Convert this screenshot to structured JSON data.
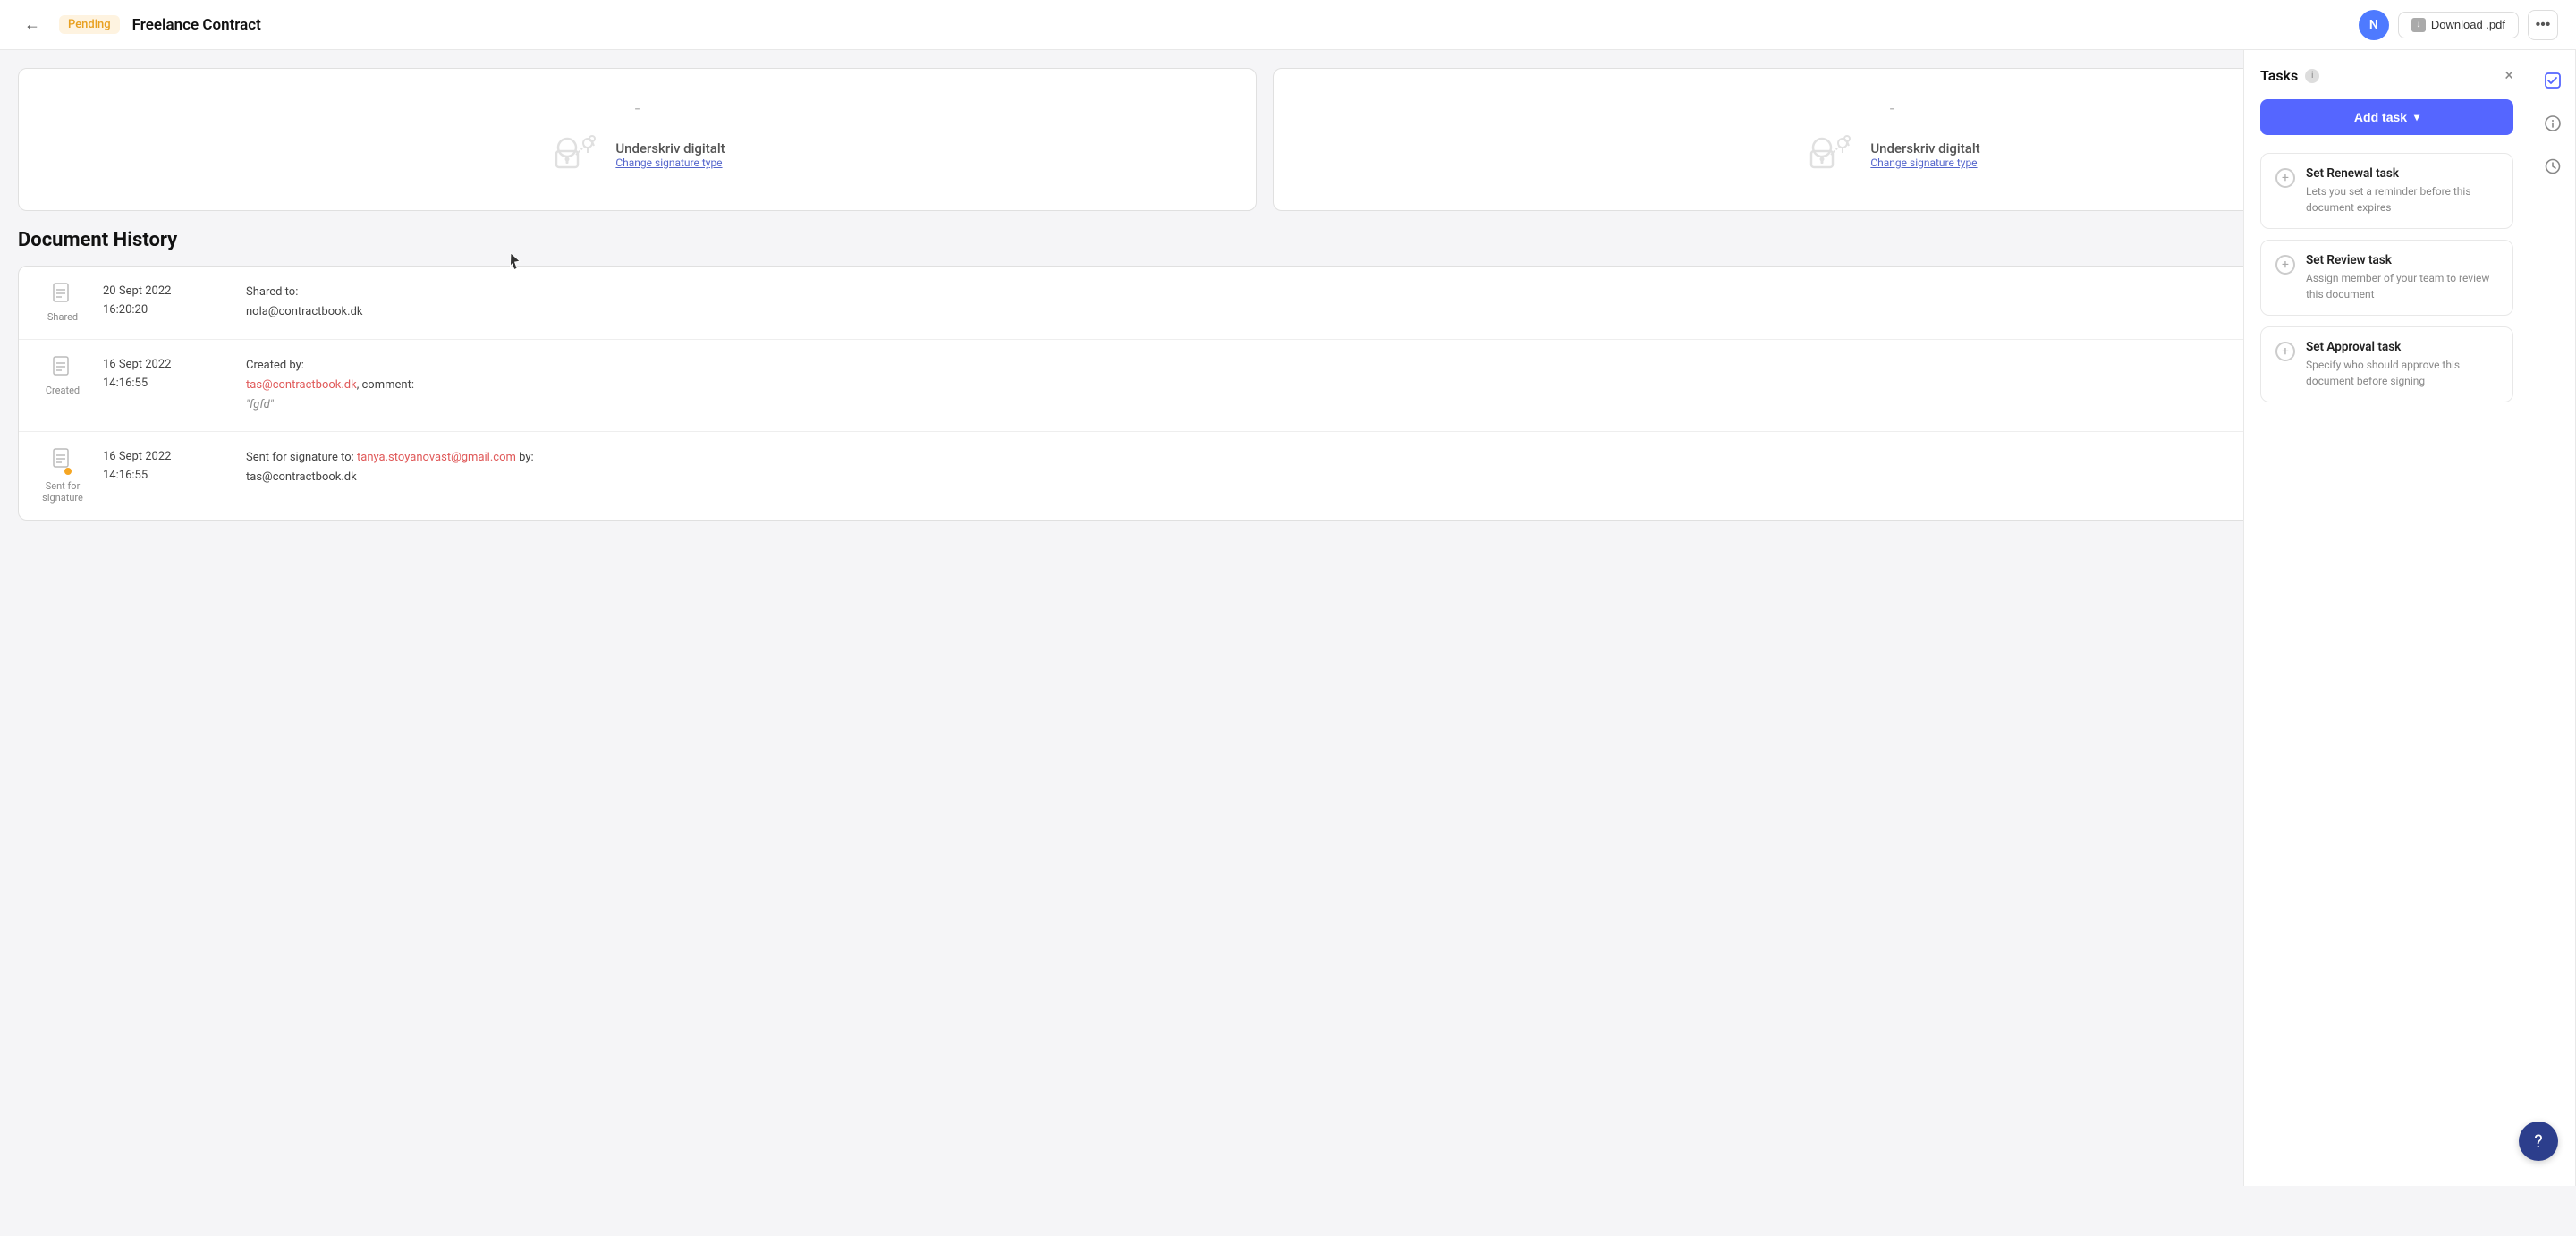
{
  "topbar": {
    "back_label": "←",
    "pending_label": "Pending",
    "doc_title": "Freelance Contract",
    "avatar_initials": "N",
    "download_label": "Download .pdf",
    "more_icon": "•••"
  },
  "doc_panels": [
    {
      "dash": "-",
      "sign_label": "Underskriv digitalt",
      "change_link": "Change signature type"
    },
    {
      "dash": "-",
      "sign_label": "Underskriv digitalt",
      "change_link": "Change signature type"
    }
  ],
  "history": {
    "title": "Document History",
    "rows": [
      {
        "status": "Shared",
        "date": "20 Sept 2022\n16:20:20",
        "detail_label": "Shared to:",
        "detail_value": "nola@contractbook.dk",
        "extra": ""
      },
      {
        "status": "Created",
        "date": "16 Sept 2022\n14:16:55",
        "detail_label": "Created by:",
        "detail_value": "tas@contractbook.dk",
        "extra": ", comment:\n\"fgfd\""
      },
      {
        "status": "Sent for\nsignature",
        "date": "16 Sept 2022\n14:16:55",
        "detail_label": "Sent for signature to:",
        "detail_value": "tanya.stoyanovast@gmail.com",
        "extra": " by:\ntas@contractbook.dk"
      }
    ]
  },
  "tasks_panel": {
    "title": "Tasks",
    "close_icon": "×",
    "add_task_label": "Add task",
    "cards": [
      {
        "title": "Set Renewal task",
        "desc": "Lets you set a reminder before this document expires"
      },
      {
        "title": "Set Review task",
        "desc": "Assign member of your team to review this document"
      },
      {
        "title": "Set Approval task",
        "desc": "Specify who should approve this document before signing"
      }
    ]
  },
  "help_btn": "?"
}
